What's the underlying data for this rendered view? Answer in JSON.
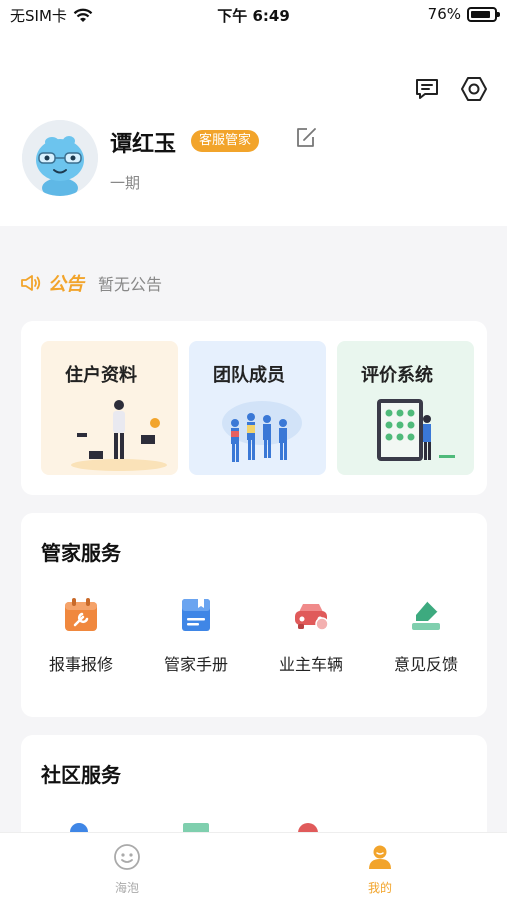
{
  "status_bar": {
    "carrier": "无SIM卡",
    "time": "下午 6:49",
    "battery_percent": "76%",
    "battery_level": 0.76
  },
  "header": {
    "icons": [
      "message-icon",
      "settings-icon"
    ],
    "user": {
      "name": "谭红玉",
      "role_badge": "客服管家",
      "subtitle": "一期",
      "avatar": "robot-avatar"
    }
  },
  "notice": {
    "title": "公告",
    "text": "暂无公告"
  },
  "quick_tiles": [
    {
      "label": "住户资料",
      "bg": "#fdf3e4"
    },
    {
      "label": "团队成员",
      "bg": "#e6f0fd"
    },
    {
      "label": "评价系统",
      "bg": "#e9f6ee"
    }
  ],
  "butler_services": {
    "title": "管家服务",
    "items": [
      {
        "label": "报事报修",
        "icon": "repair-calendar-icon",
        "color": "#f0883e"
      },
      {
        "label": "管家手册",
        "icon": "handbook-icon",
        "color": "#3f86e6"
      },
      {
        "label": "业主车辆",
        "icon": "car-icon",
        "color": "#e05a5a"
      },
      {
        "label": "意见反馈",
        "icon": "feedback-icon",
        "color": "#3daa7f"
      }
    ]
  },
  "community_services": {
    "title": "社区服务"
  },
  "tab_bar": {
    "tabs": [
      {
        "label": "海泡",
        "icon": "smile-icon",
        "active": false
      },
      {
        "label": "我的",
        "icon": "profile-icon",
        "active": true
      }
    ]
  },
  "colors": {
    "accent": "#f2a42b",
    "page_bg": "#f5f5f7",
    "inactive_tab": "#aaaaaa"
  }
}
